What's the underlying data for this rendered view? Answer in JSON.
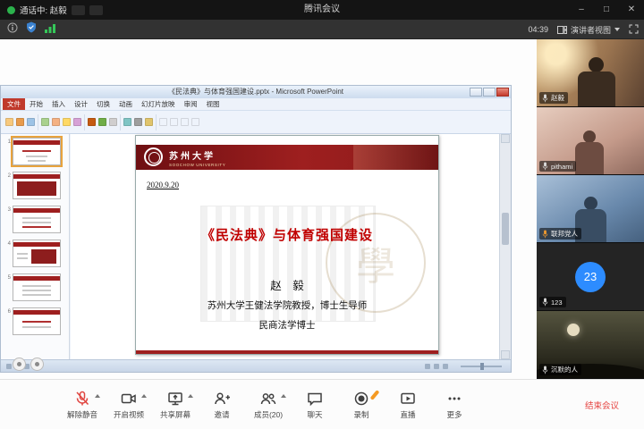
{
  "titlebar": {
    "call_status": "通话中: 赵毅",
    "app_title": "腾讯会议",
    "minimize": "–",
    "maximize": "□",
    "close": "✕"
  },
  "toolbar": {
    "timer": "04:39",
    "view_mode": "演讲者视图"
  },
  "ppt": {
    "window_title": "《民法典》与体育强国建设.pptx - Microsoft PowerPoint",
    "tabs": [
      "文件",
      "开始",
      "插入",
      "设计",
      "切换",
      "动画",
      "幻灯片放映",
      "审阅",
      "视图"
    ],
    "thumb_numbers": [
      "1",
      "2",
      "3",
      "4",
      "5",
      "6"
    ],
    "slide": {
      "school_cn": "苏州大学",
      "school_en": "SOOCHOW UNIVERSITY",
      "date": "2020.9.20",
      "title": "《民法典》与体育强国建设",
      "author": "赵　毅",
      "line1": "苏州大学王健法学院教授，博士生导师",
      "line2": "民商法学博士",
      "watermark": "學"
    }
  },
  "participants": [
    {
      "name": "赵毅"
    },
    {
      "name": "pithami"
    },
    {
      "name": "联邦党人"
    },
    {
      "name": "123",
      "badge": "23"
    },
    {
      "name": "沉默的人"
    }
  ],
  "controls": [
    {
      "label": "解除静音"
    },
    {
      "label": "开启视频"
    },
    {
      "label": "共享屏幕"
    },
    {
      "label": "邀请"
    },
    {
      "label": "成员(20)"
    },
    {
      "label": "聊天"
    },
    {
      "label": "录制"
    },
    {
      "label": "直播"
    },
    {
      "label": "更多"
    }
  ],
  "end_meeting": "结束会议",
  "colors": {
    "accent_blue": "#2d8cff",
    "danger_red": "#e64340",
    "ppt_banner_red": "#9e1f1f",
    "slide_title_red": "#c00000"
  }
}
